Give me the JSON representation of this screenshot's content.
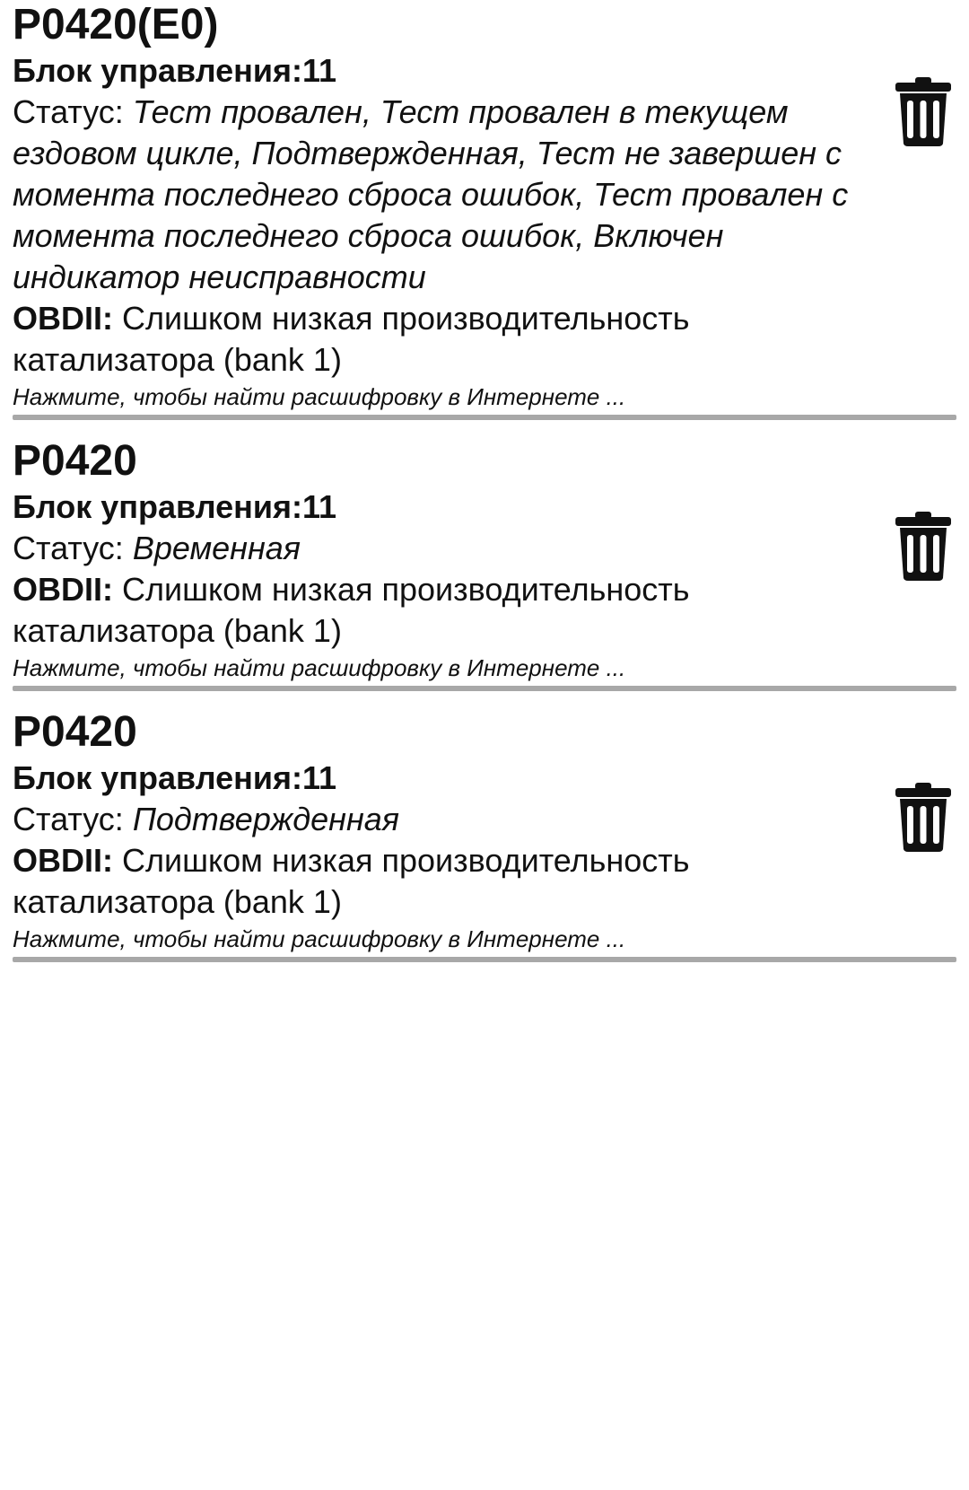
{
  "items": [
    {
      "code": "P0420(E0)",
      "ecu_label": "Блок управления:",
      "ecu_value": "11",
      "status_label": "Статус: ",
      "status_value": "Тест провален, Тест провален в текущем ездовом цикле, Подтвержденная, Тест не завершен с момента последнего сброса ошибок, Тест провален с момента последнего сброса ошибок, Включен индикатор неисправности",
      "desc_label": "OBDII:",
      "desc_value": " Слишком низкая производительность катализатора (bank 1)",
      "hint": "Нажмите, чтобы найти расшифровку в Интернете ..."
    },
    {
      "code": "P0420",
      "ecu_label": "Блок управления:",
      "ecu_value": "11",
      "status_label": "Статус: ",
      "status_value": "Временная",
      "desc_label": "OBDII:",
      "desc_value": " Слишком низкая производительность катализатора (bank 1)",
      "hint": "Нажмите, чтобы найти расшифровку в Интернете ..."
    },
    {
      "code": "P0420",
      "ecu_label": "Блок управления:",
      "ecu_value": "11",
      "status_label": "Статус: ",
      "status_value": "Подтвержденная",
      "desc_label": "OBDII:",
      "desc_value": " Слишком низкая производительность катализатора (bank 1)",
      "hint": "Нажмите, чтобы найти расшифровку в Интернете ..."
    }
  ],
  "icons": {
    "delete": "trash-icon"
  },
  "colors": {
    "text": "#111111",
    "divider": "#a8a8a8",
    "background": "#ffffff"
  }
}
